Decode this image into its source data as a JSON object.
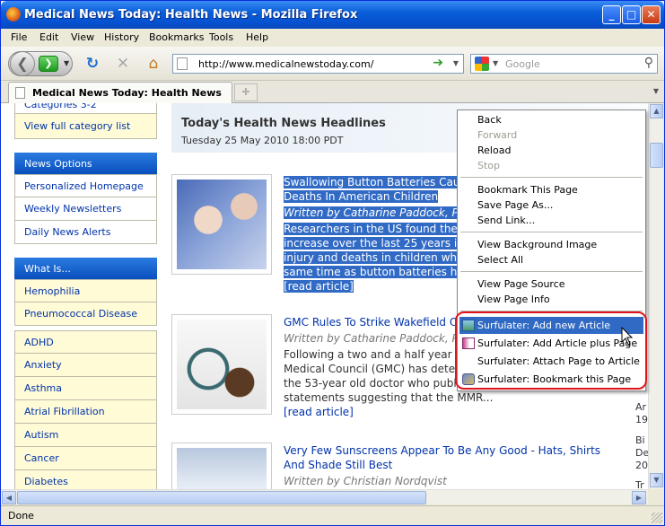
{
  "window": {
    "title": "Medical News Today: Health News - Mozilla Firefox"
  },
  "menubar": [
    "File",
    "Edit",
    "View",
    "History",
    "Bookmarks",
    "Tools",
    "Help"
  ],
  "navigation": {
    "url": "http://www.medicalnewstoday.com/",
    "search_placeholder": "Google"
  },
  "tab": {
    "label": "Medical News Today: Health News"
  },
  "sidebar": {
    "top_partial": "Categories 3-2",
    "view_full": "View full category list",
    "news_options": {
      "heading": "News Options",
      "items": [
        "Personalized Homepage",
        "Weekly Newsletters",
        "Daily News Alerts"
      ]
    },
    "what_is": {
      "heading": "What Is...",
      "items": [
        "Hemophilia",
        "Pneumococcal Disease"
      ]
    },
    "conditions": [
      "ADHD",
      "Anxiety",
      "Asthma",
      "Atrial Fibrillation",
      "Autism",
      "Cancer",
      "Diabetes"
    ]
  },
  "main": {
    "heading": "Today's Health News Headlines",
    "date": "Tuesday 25 May 2010 18:00 PDT",
    "articles": [
      {
        "title_line1": "Swallowing Button Batteries Caus",
        "title_line2": "Deaths In American Children",
        "byline": "Written by Catharine Paddock, PhD",
        "body_lines": [
          "Researchers in the US found ther",
          "increase over the last 25 years in",
          "injury and deaths in children who",
          "same time as button batteries hav"
        ],
        "more": "[read article]"
      },
      {
        "title": "GMC Rules To Strike Wakefield O",
        "byline": "Written by Catharine Paddock, PhD",
        "body_lines": [
          "Following a two and a half year in",
          "Medical Council (GMC) has deter",
          "the 53-year old doctor who publis",
          "statements suggesting that the MMR..."
        ],
        "more": "[read article]"
      },
      {
        "title_line1": "Very Few Sunscreens Appear To Be Any Good - Hats, Shirts",
        "title_line2": "And Shade Still Best",
        "byline": "Written by Christian Nordqvist"
      }
    ],
    "right_col": [
      "Ar",
      "19",
      "Bi",
      "De",
      "20",
      "Tr"
    ]
  },
  "context_menu": {
    "items": [
      {
        "label": "Back",
        "disabled": false
      },
      {
        "label": "Forward",
        "disabled": true
      },
      {
        "label": "Reload",
        "disabled": false
      },
      {
        "label": "Stop",
        "disabled": true
      },
      {
        "label": "Bookmark This Page",
        "disabled": false
      },
      {
        "label": "Save Page As...",
        "disabled": false
      },
      {
        "label": "Send Link...",
        "disabled": false
      },
      {
        "label": "View Background Image",
        "disabled": false
      },
      {
        "label": "Select All",
        "disabled": false
      },
      {
        "label": "View Page Source",
        "disabled": false
      },
      {
        "label": "View Page Info",
        "disabled": false
      },
      {
        "label": "Surfulater: Add new Article",
        "highlighted": true
      },
      {
        "label": "Surfulater: Add Article plus Page"
      },
      {
        "label": "Surfulater: Attach Page to Article"
      },
      {
        "label": "Surfulater: Bookmark this Page"
      }
    ]
  },
  "status": "Done",
  "colors": {
    "title_bar": "#0a5fd8",
    "selection": "#316ac5",
    "link": "#0033aa",
    "sidebar_heading": "#0a4fbf",
    "annotation_oval": "#e0141e"
  }
}
